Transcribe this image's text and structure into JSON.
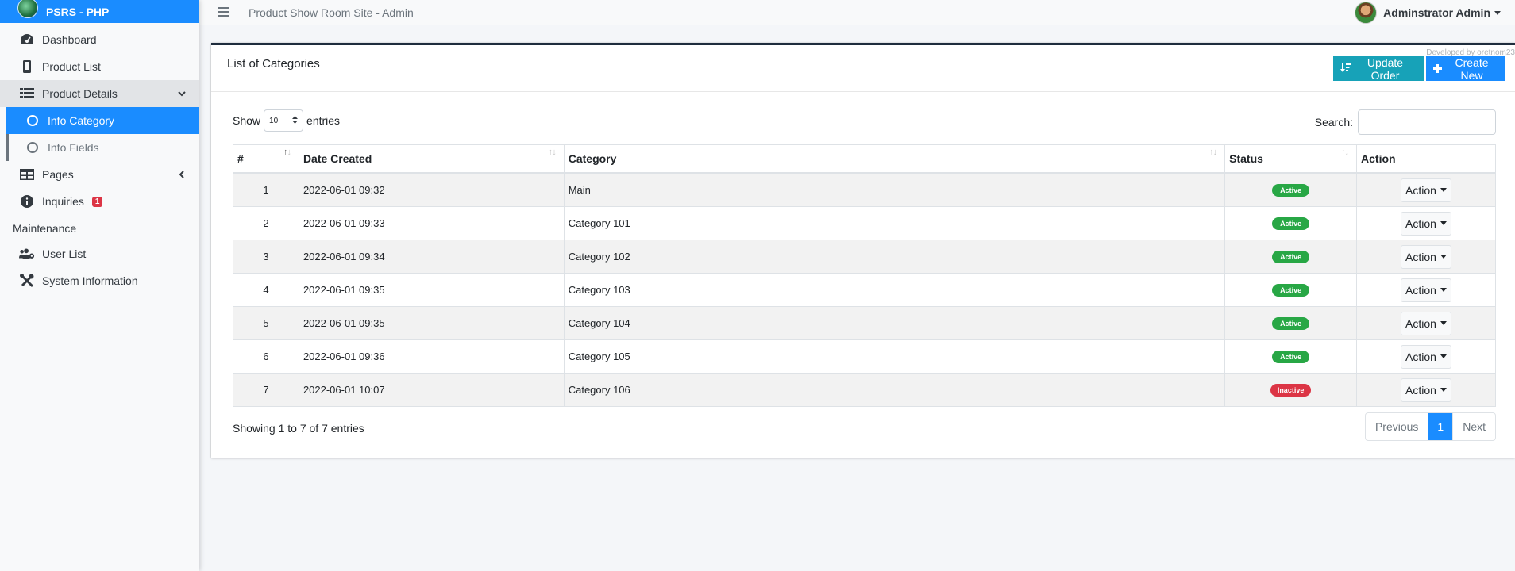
{
  "app": {
    "brand": "PSRS - PHP",
    "site_title": "Product Show Room Site - Admin"
  },
  "user": {
    "name": "Adminstrator Admin"
  },
  "sidebar": {
    "items": [
      {
        "label": "Dashboard",
        "icon": "tachometer-icon"
      },
      {
        "label": "Product List",
        "icon": "mobile-icon"
      },
      {
        "label": "Product Details",
        "icon": "list-icon"
      },
      {
        "label": "Info Category",
        "icon": "circle-icon"
      },
      {
        "label": "Info Fields",
        "icon": "circle-icon"
      },
      {
        "label": "Pages",
        "icon": "table-icon"
      },
      {
        "label": "Inquiries",
        "icon": "info-circle-icon",
        "badge": "1"
      }
    ],
    "section_header": "Maintenance",
    "maintenance": [
      {
        "label": "User List",
        "icon": "users-cog-icon"
      },
      {
        "label": "System Information",
        "icon": "tools-icon"
      }
    ]
  },
  "card": {
    "title": "List of Categories",
    "dev_credit": "Developed by oretnom23",
    "update_order_label": "Update Order",
    "create_new_label": "Create New"
  },
  "table_controls": {
    "show_label": "Show",
    "length_value": "10",
    "entries_label": "entries",
    "search_label": "Search:",
    "search_value": ""
  },
  "table": {
    "headers": [
      "#",
      "Date Created",
      "Category",
      "Status",
      "Action"
    ],
    "rows": [
      {
        "num": "1",
        "date": "2022-06-01 09:32",
        "category": "Main",
        "status": "Active",
        "action": "Action"
      },
      {
        "num": "2",
        "date": "2022-06-01 09:33",
        "category": "Category 101",
        "status": "Active",
        "action": "Action"
      },
      {
        "num": "3",
        "date": "2022-06-01 09:34",
        "category": "Category 102",
        "status": "Active",
        "action": "Action"
      },
      {
        "num": "4",
        "date": "2022-06-01 09:35",
        "category": "Category 103",
        "status": "Active",
        "action": "Action"
      },
      {
        "num": "5",
        "date": "2022-06-01 09:35",
        "category": "Category 104",
        "status": "Active",
        "action": "Action"
      },
      {
        "num": "6",
        "date": "2022-06-01 09:36",
        "category": "Category 105",
        "status": "Active",
        "action": "Action"
      },
      {
        "num": "7",
        "date": "2022-06-01 10:07",
        "category": "Category 106",
        "status": "Inactive",
        "action": "Action"
      }
    ]
  },
  "footer": {
    "info": "Showing 1 to 7 of 7 entries",
    "previous": "Previous",
    "current_page": "1",
    "next": "Next"
  },
  "colors": {
    "primary": "#1a8cff",
    "info": "#17a2b8",
    "success": "#28a745",
    "danger": "#dc3545",
    "card_top": "#1f2d3d"
  }
}
